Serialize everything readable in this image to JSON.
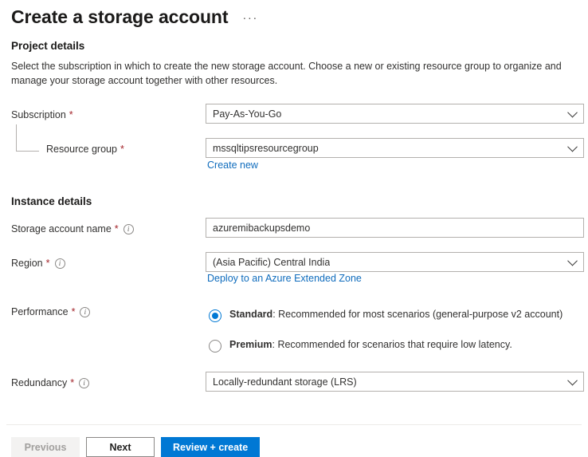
{
  "header": {
    "title": "Create a storage account",
    "more_menu": "···"
  },
  "sections": {
    "project": {
      "heading": "Project details",
      "description": "Select the subscription in which to create the new storage account. Choose a new or existing resource group to organize and manage your storage account together with other resources.",
      "subscription": {
        "label": "Subscription",
        "required": "*",
        "value": "Pay-As-You-Go"
      },
      "resource_group": {
        "label": "Resource group",
        "required": "*",
        "value": "mssqltipsresourcegroup",
        "create_new_link": "Create new"
      }
    },
    "instance": {
      "heading": "Instance details",
      "storage_account_name": {
        "label": "Storage account name",
        "required": "*",
        "value": "azuremibackupsdemo",
        "placeholder": ""
      },
      "region": {
        "label": "Region",
        "required": "*",
        "value": "(Asia Pacific) Central India",
        "extended_zone_link": "Deploy to an Azure Extended Zone"
      },
      "performance": {
        "label": "Performance",
        "required": "*",
        "options": [
          {
            "name": "Standard",
            "description": ": Recommended for most scenarios (general-purpose v2 account)",
            "selected": true
          },
          {
            "name": "Premium",
            "description": ": Recommended for scenarios that require low latency.",
            "selected": false
          }
        ]
      },
      "redundancy": {
        "label": "Redundancy",
        "required": "*",
        "value": "Locally-redundant storage (LRS)"
      }
    }
  },
  "footer": {
    "previous_label": "Previous",
    "next_label": "Next",
    "review_create_label": "Review + create"
  },
  "icons": {
    "info": "i",
    "chevron_down": "chevron-down-icon"
  },
  "colors": {
    "accent": "#0078d4",
    "link": "#0f6cbd",
    "required_asterisk": "#a4262c",
    "border": "#b3b0ad",
    "disabled_bg": "#f3f2f1"
  }
}
